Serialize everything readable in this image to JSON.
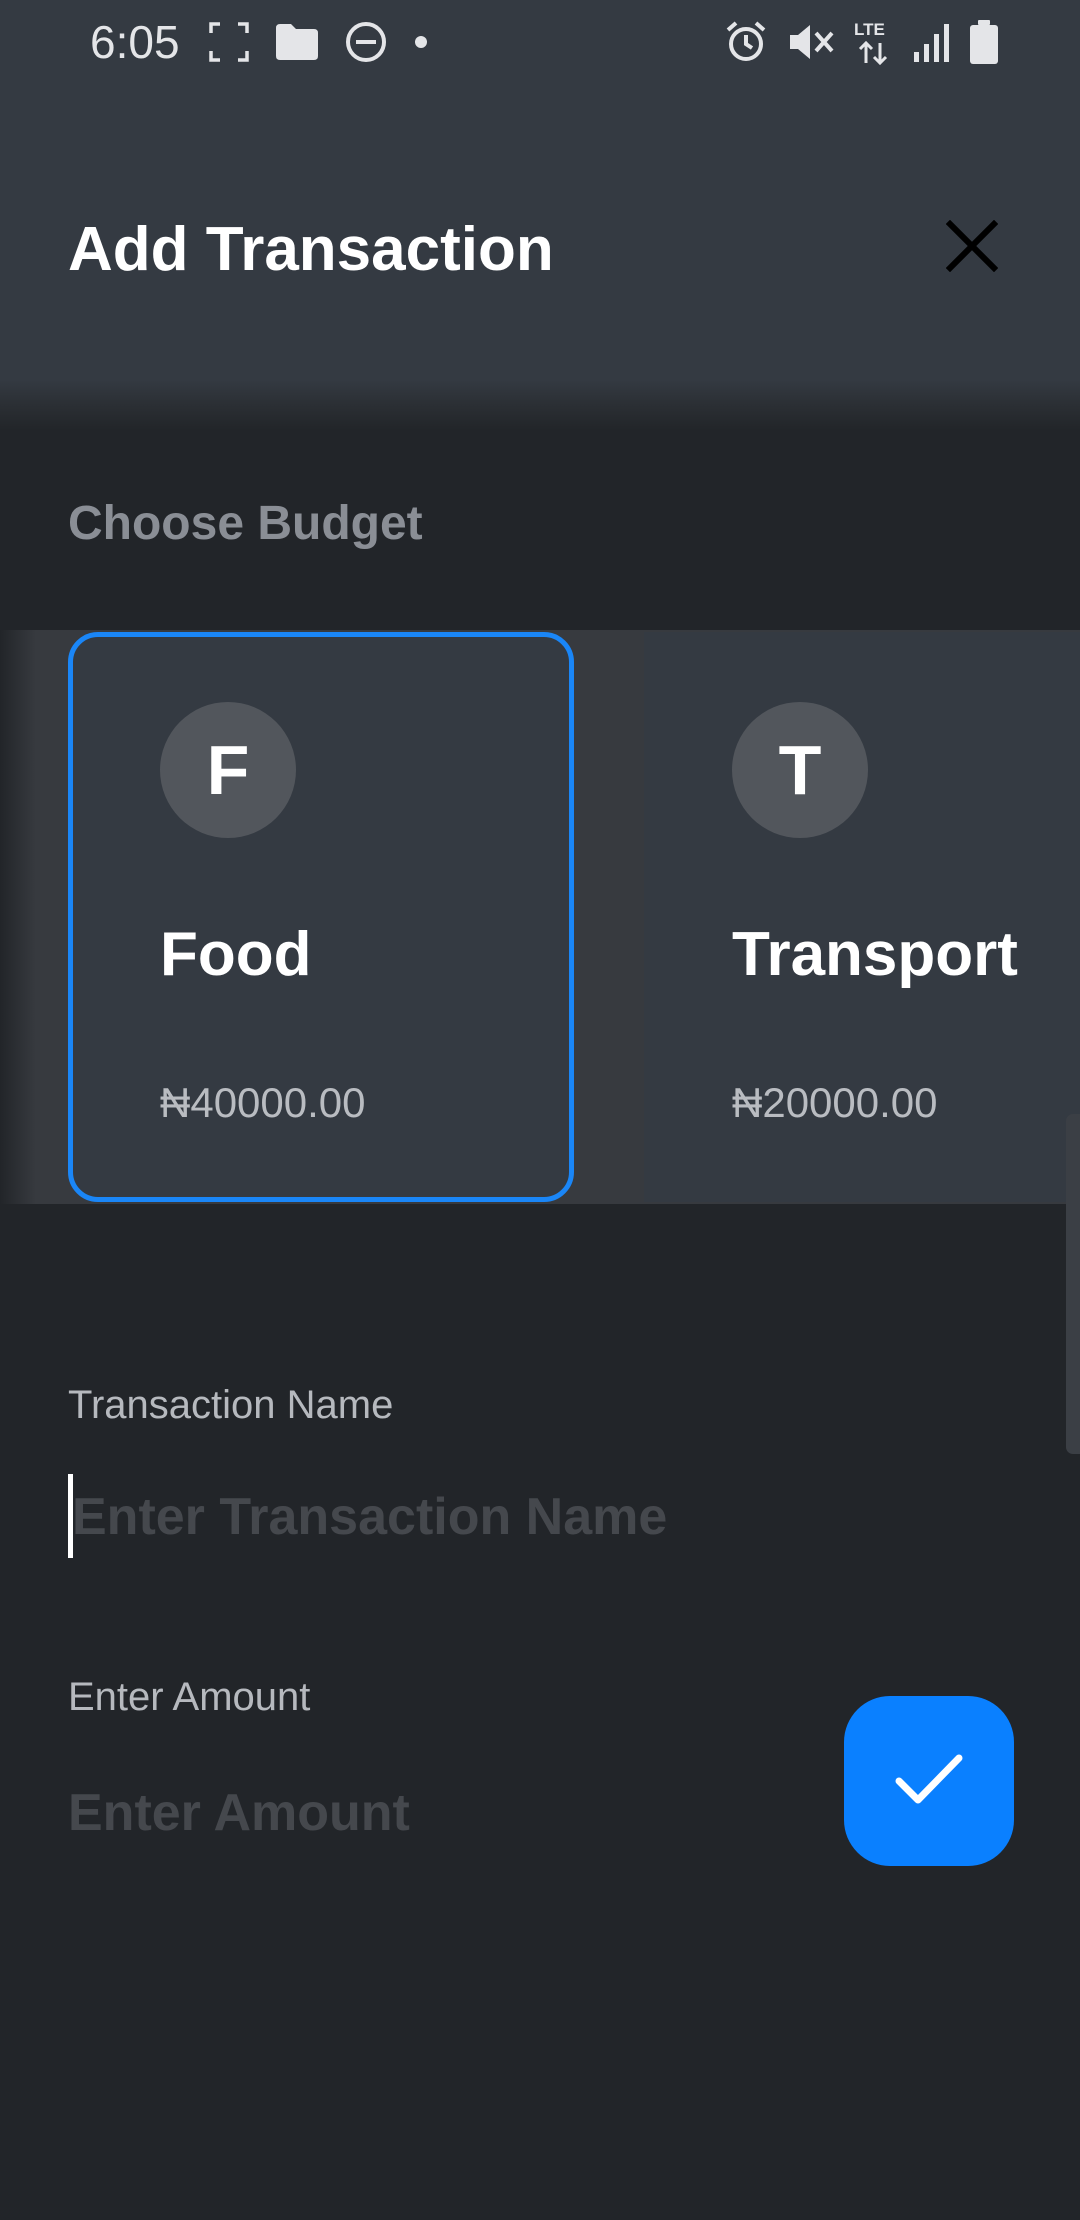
{
  "status_bar": {
    "time": "6:05",
    "left_icons": [
      "screenshot-frame-icon",
      "folder-icon",
      "do-not-disturb-icon",
      "dot-icon"
    ],
    "right_icons": [
      "alarm-icon",
      "mute-icon",
      "lte-icon",
      "signal-icon",
      "battery-icon"
    ]
  },
  "header": {
    "title": "Add Transaction",
    "close_icon": "close-icon"
  },
  "budget_section": {
    "label": "Choose Budget",
    "cards": [
      {
        "initial": "F",
        "name": "Food",
        "amount": "₦40000.00",
        "selected": true
      },
      {
        "initial": "T",
        "name": "Transport",
        "amount": "₦20000.00",
        "selected": false
      }
    ]
  },
  "form": {
    "name_label": "Transaction Name",
    "name_placeholder": "Enter Transaction Name",
    "name_value": "",
    "amount_label": "Enter Amount",
    "amount_placeholder": "Enter Amount",
    "amount_value": ""
  },
  "fab": {
    "icon": "check-icon"
  },
  "colors": {
    "background": "#222529",
    "app_bar": "#343a42",
    "accent": "#0a80ff",
    "selected_border": "#1a86f7"
  }
}
